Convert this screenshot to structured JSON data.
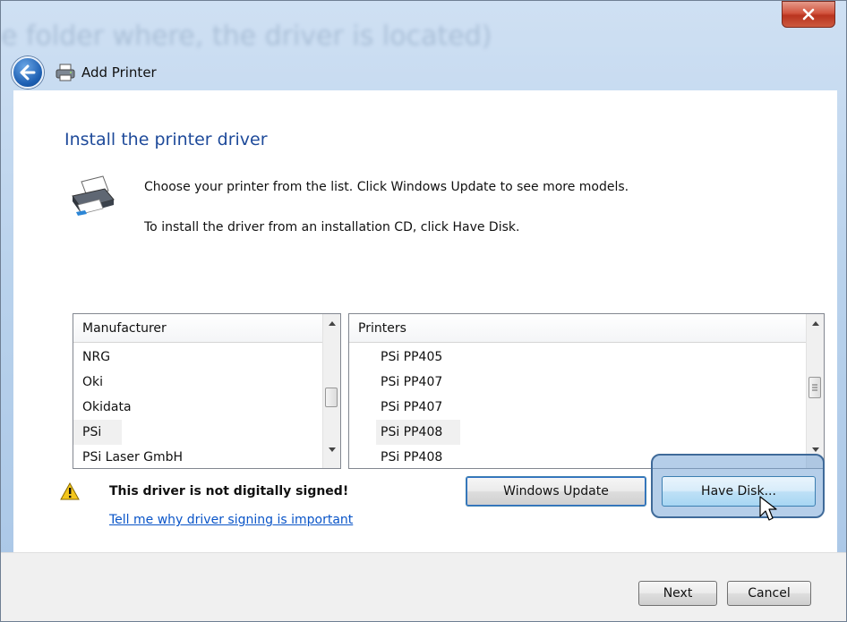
{
  "window": {
    "background_title": "e folder where, the driver is located)",
    "title": "Add Printer",
    "close_glyph": "x"
  },
  "page": {
    "heading": "Install the printer driver",
    "instruction_1": "Choose your printer from the list. Click Windows Update to see more models.",
    "instruction_2": "To install the driver from an installation CD, click Have Disk."
  },
  "manufacturer_list": {
    "header": "Manufacturer",
    "items": [
      "NRG",
      "Oki",
      "Okidata",
      "PSi",
      "PSi Laser GmbH"
    ],
    "selected": "PSi"
  },
  "printers_list": {
    "header": "Printers",
    "items": [
      "PSi PP405",
      "PSi PP407",
      "PSi PP407",
      "PSi PP408",
      "PSi PP408"
    ],
    "selected": "PSi PP408"
  },
  "warning": {
    "text": "This driver is not digitally signed!",
    "link": "Tell me why driver signing is important"
  },
  "buttons": {
    "windows_update": "Windows Update",
    "have_disk": "Have Disk...",
    "next": "Next",
    "cancel": "Cancel"
  },
  "colors": {
    "heading": "#1e4a9a",
    "link": "#0a55c8",
    "highlight": "#3f6a99"
  }
}
